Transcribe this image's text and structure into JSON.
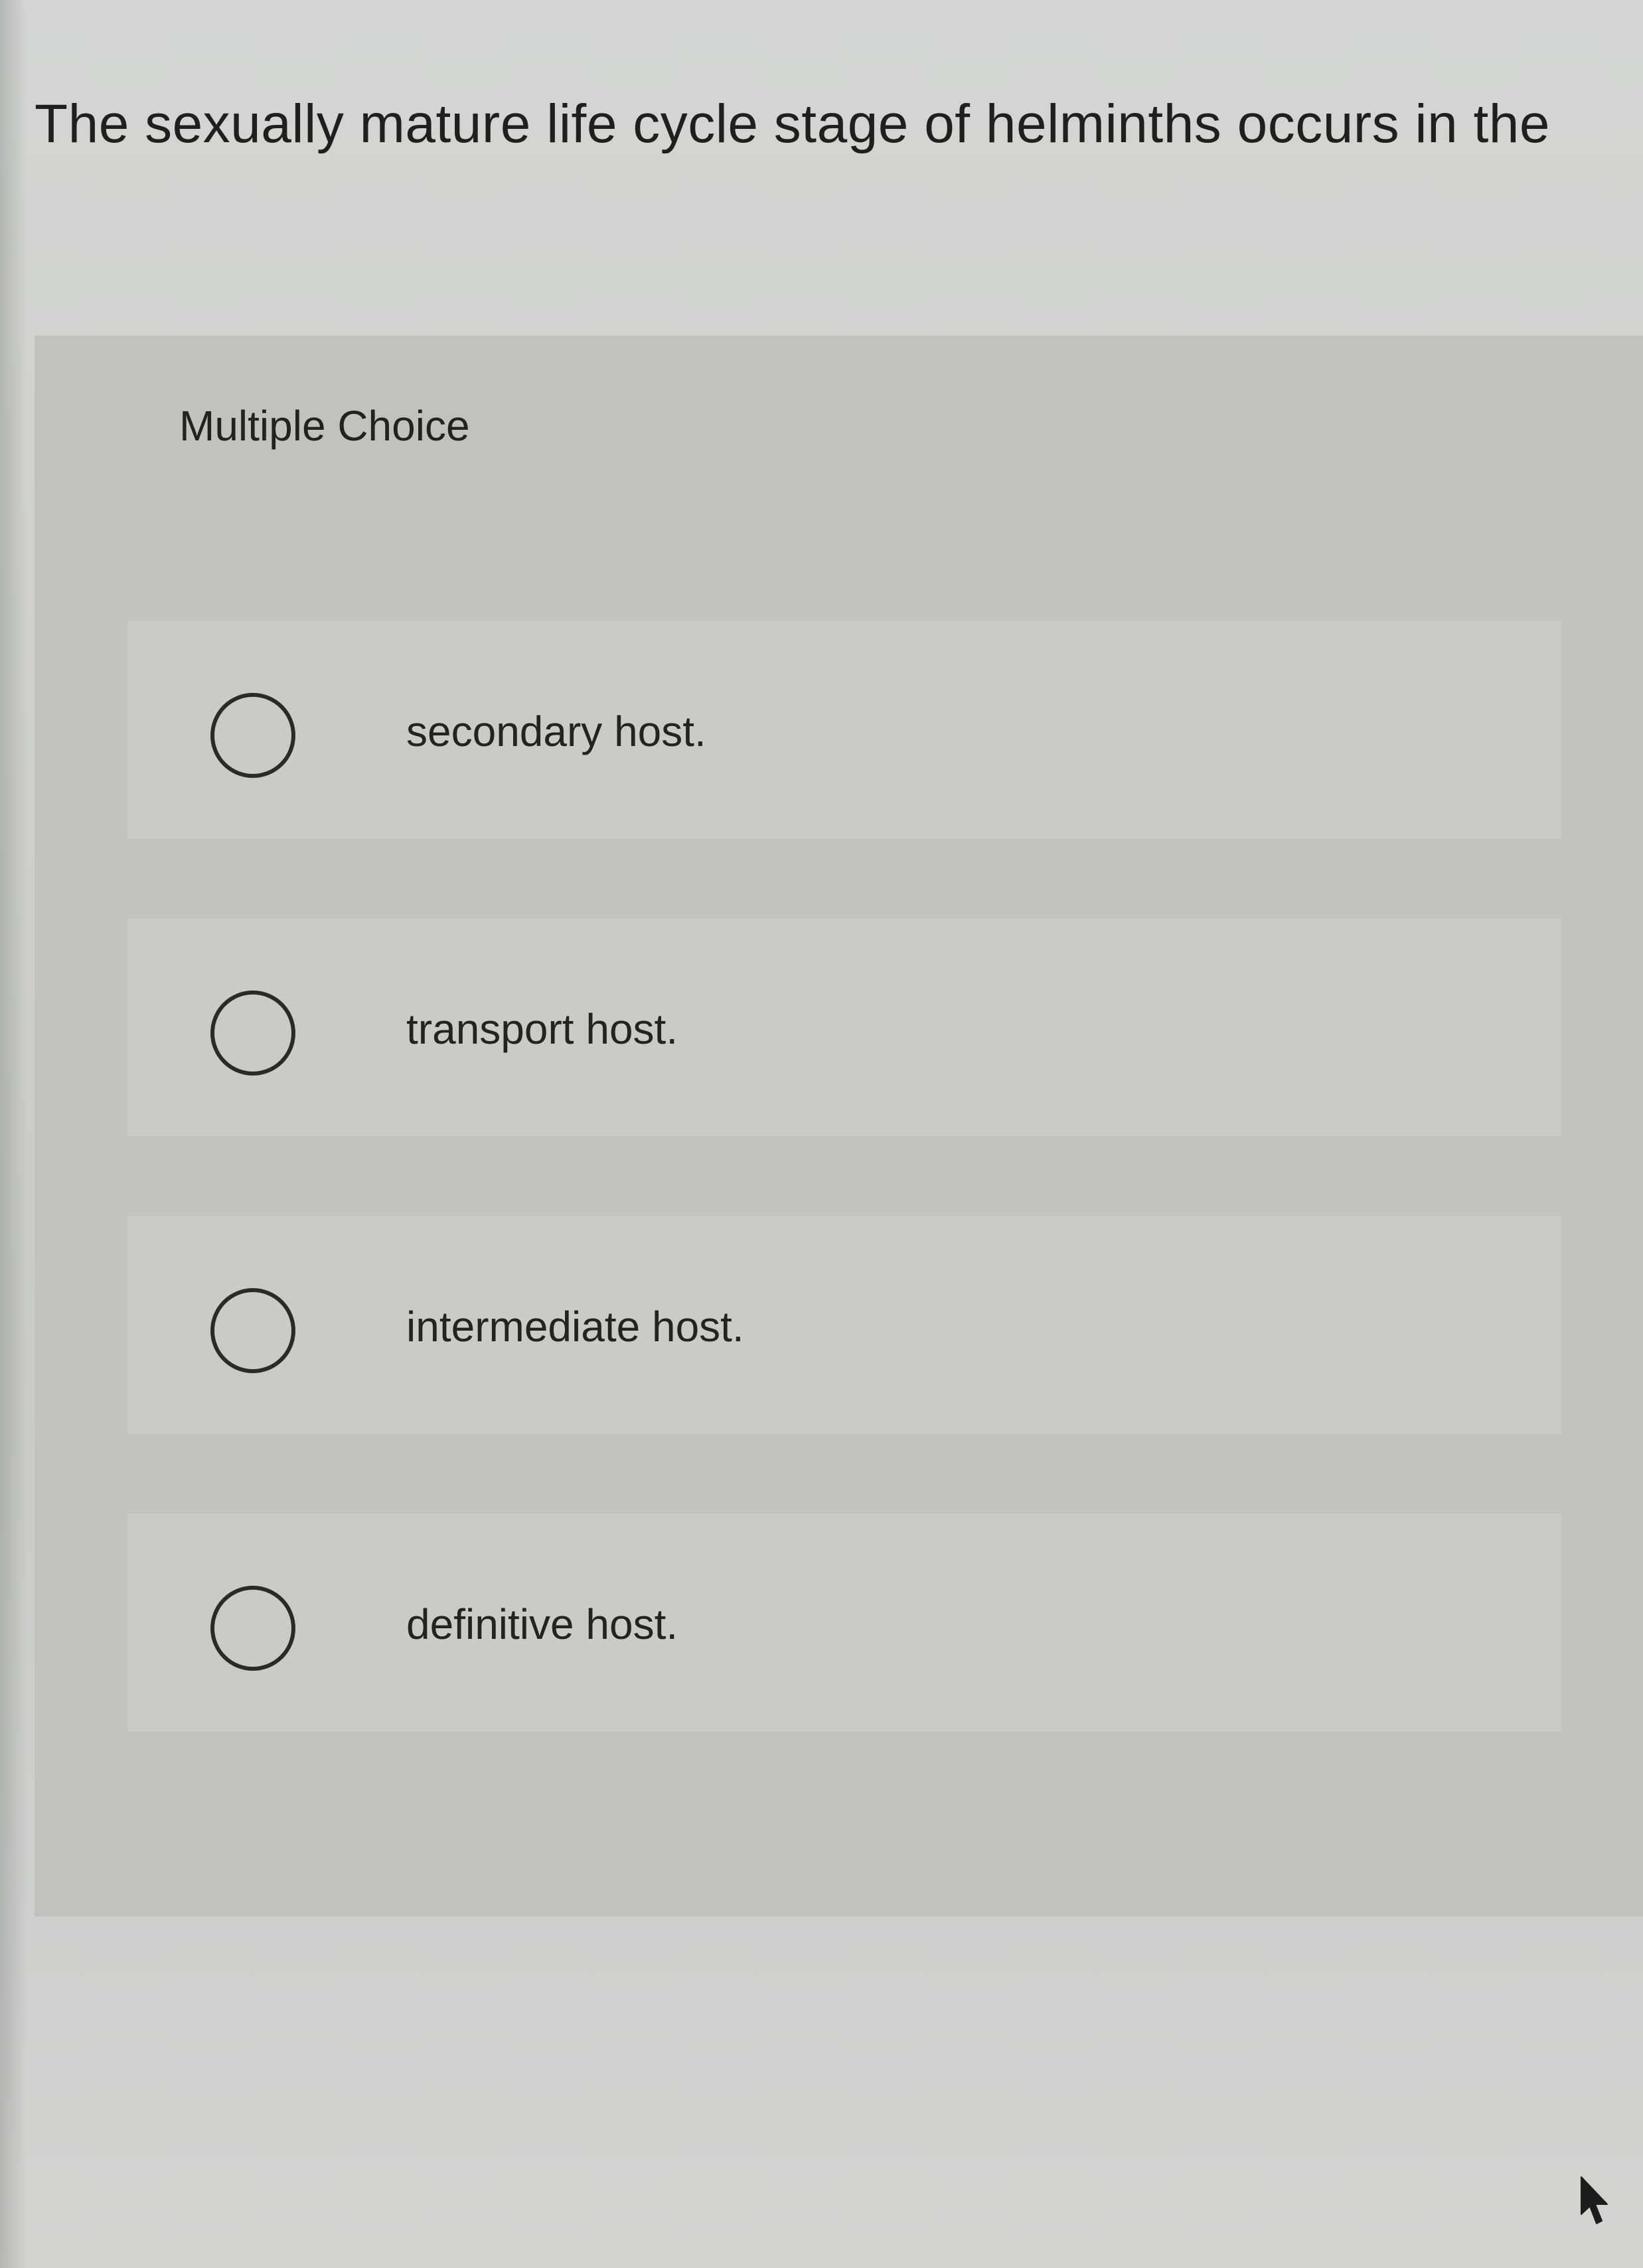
{
  "question": {
    "text": "The sexually mature life cycle stage of helminths occurs in the"
  },
  "panel": {
    "title": "Multiple Choice"
  },
  "choices": [
    {
      "label": "secondary host."
    },
    {
      "label": "transport host."
    },
    {
      "label": "intermediate host."
    },
    {
      "label": "definitive host."
    }
  ],
  "icons": {
    "radio": "radio-circle-icon",
    "cursor": "mouse-pointer-icon"
  }
}
